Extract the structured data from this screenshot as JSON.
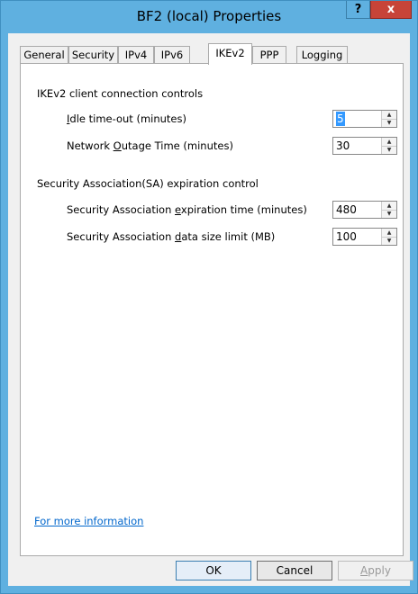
{
  "window": {
    "title": "BF2 (local) Properties",
    "help_label": "?",
    "close_label": "x"
  },
  "tabs": [
    {
      "label": "General"
    },
    {
      "label": "Security"
    },
    {
      "label": "IPv4"
    },
    {
      "label": "IPv6"
    },
    {
      "label": "IKEv2"
    },
    {
      "label": "PPP"
    },
    {
      "label": "Logging"
    }
  ],
  "active_tab": "IKEv2",
  "client_controls": {
    "heading": "IKEv2 client connection controls",
    "idle_timeout": {
      "label_underlined": "I",
      "label_rest": "dle time-out (minutes)",
      "value": "5"
    },
    "network_outage": {
      "label_pre": "Network ",
      "label_underlined": "O",
      "label_rest": "utage Time (minutes)",
      "value": "30"
    }
  },
  "sa_controls": {
    "heading": "Security Association(SA) expiration control",
    "expiration_time": {
      "label_pre": "Security Association ",
      "label_underlined": "e",
      "label_rest": "xpiration time (minutes)",
      "value": "480"
    },
    "data_size": {
      "label_pre": "Security Association ",
      "label_underlined": "d",
      "label_rest": "ata size limit (MB)",
      "value": "100"
    }
  },
  "more_info_link": "For more information",
  "buttons": {
    "ok": "OK",
    "cancel": "Cancel",
    "apply_underlined": "A",
    "apply_rest": "pply"
  }
}
